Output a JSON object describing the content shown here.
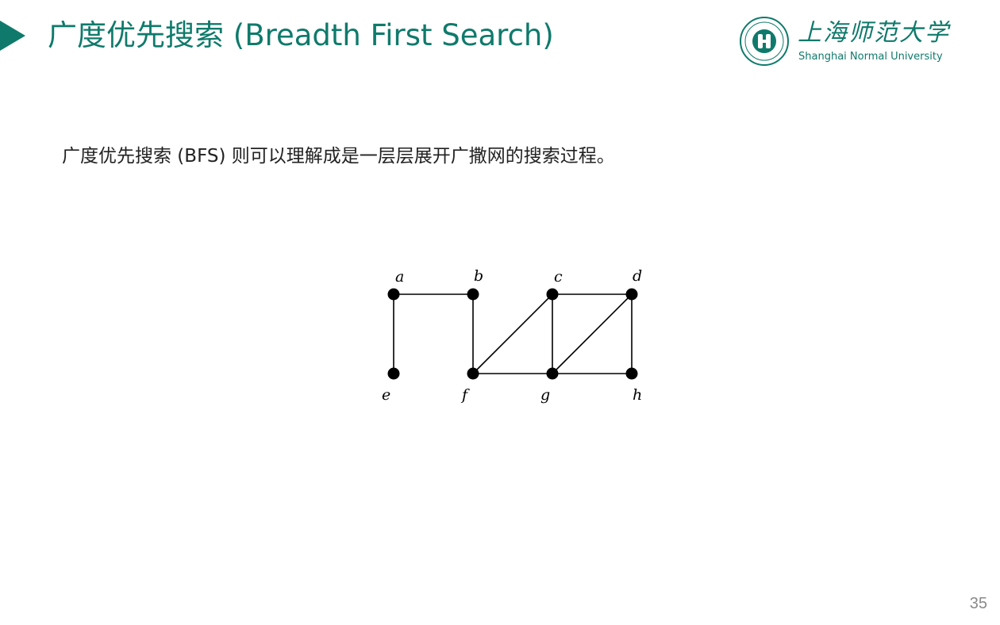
{
  "header": {
    "title": "广度优先搜索 (Breadth First Search)"
  },
  "logo": {
    "name_cn": "上海师范大学",
    "name_en": "Shanghai Normal University",
    "seal_text": "SHANGHAI NORMAL UNIVERSITY"
  },
  "content": {
    "description": "广度优先搜索 (BFS) 则可以理解成是一层层展开广撒网的搜索过程。"
  },
  "graph": {
    "nodes": [
      "a",
      "b",
      "c",
      "d",
      "e",
      "f",
      "g",
      "h"
    ],
    "edges": [
      [
        "a",
        "b"
      ],
      [
        "a",
        "e"
      ],
      [
        "b",
        "f"
      ],
      [
        "c",
        "d"
      ],
      [
        "c",
        "g"
      ],
      [
        "c",
        "f"
      ],
      [
        "d",
        "h"
      ],
      [
        "d",
        "g"
      ],
      [
        "f",
        "g"
      ],
      [
        "g",
        "h"
      ]
    ]
  },
  "footer": {
    "page_number": "35"
  },
  "colors": {
    "accent": "#0f7a6b",
    "text": "#222222",
    "page_number": "#8a8a8a"
  }
}
